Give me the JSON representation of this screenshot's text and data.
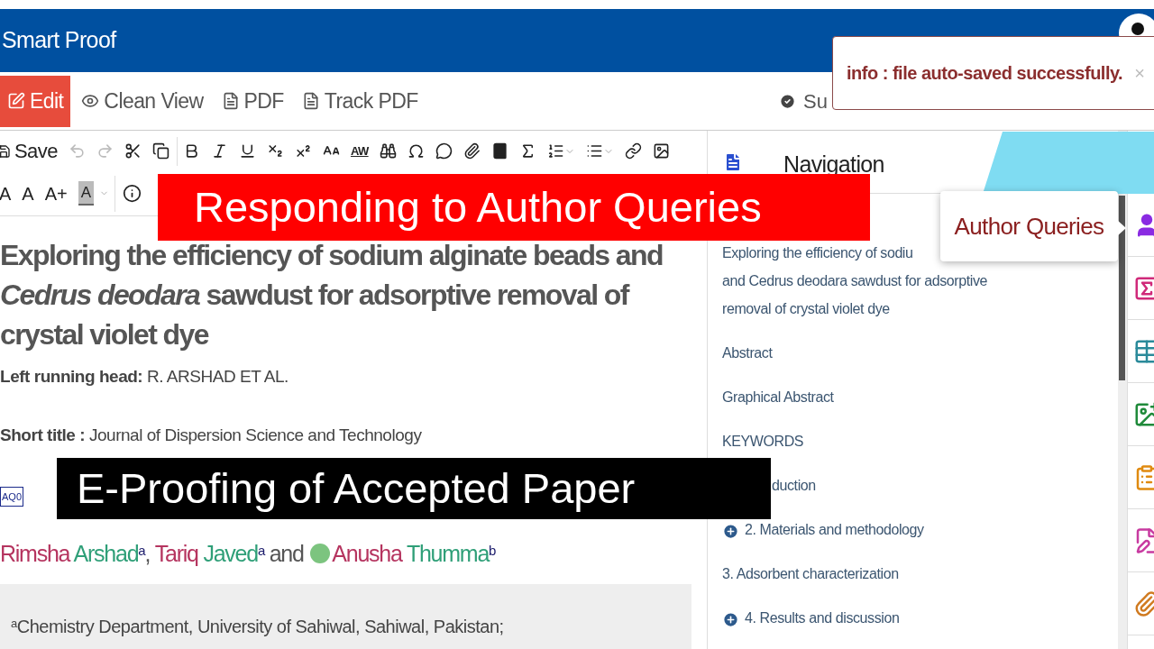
{
  "header": {
    "title": "Smart Proof"
  },
  "menu": {
    "tabs": [
      {
        "label": "Edit",
        "selected": true
      },
      {
        "label": "Clean View",
        "selected": false
      },
      {
        "label": "PDF",
        "selected": false
      },
      {
        "label": "Track PDF",
        "selected": false
      }
    ],
    "status_label": "Su"
  },
  "toast": {
    "message": "info : file auto-saved successfully.",
    "close": "×"
  },
  "toolbar": {
    "save": "Save",
    "undo_disabled": true,
    "redo_disabled": true,
    "spell_label": "AW",
    "font_buttons": [
      "A",
      "A",
      "A+"
    ],
    "highlight_label": "A"
  },
  "document": {
    "title": "Exploring the efficiency of sodium alginate beads and *Cedrus deodara* sawdust for adsorptive removal of crystal violet dye",
    "running_head": {
      "label": "Left running head:",
      "value": "R. ARSHAD ET AL."
    },
    "short_title": {
      "label": "Short title :",
      "value": "Journal of Dispersion Science and Technology"
    },
    "query_marker": "AQ0",
    "authors": [
      {
        "given": "Rimsha",
        "family": "Arshad",
        "affiliation": "a",
        "orcid": false,
        "after": ", "
      },
      {
        "given": "Tariq",
        "family": "Javed",
        "affiliation": "a",
        "orcid": false,
        "after": " and "
      },
      {
        "given": "Anusha",
        "family": "Thumma",
        "affiliation": "b",
        "orcid": true
      }
    ],
    "affiliation": {
      "mark": "a",
      "text": "Chemistry Department, University of Sahiwal, Sahiwal, Pakistan;"
    }
  },
  "navigation": {
    "title": "Navigation",
    "tooltip": "Author Queries",
    "items": [
      {
        "kind": "plain",
        "covered": false,
        "lines": [
          "Exploring the efficiency of sodiu",
          "and Cedrus deodara sawdust for adsorptive",
          "removal of crystal violet dye"
        ]
      },
      {
        "kind": "plain",
        "covered": false,
        "lines": [
          "Abstract"
        ]
      },
      {
        "kind": "plain",
        "covered": false,
        "lines": [
          "Graphical Abstract"
        ]
      },
      {
        "kind": "plain",
        "covered": false,
        "lines": [
          "KEYWORDS"
        ]
      },
      {
        "kind": "plain",
        "covered": true,
        "lines": [
          "duction"
        ]
      },
      {
        "kind": "expandable",
        "covered": false,
        "lines": [
          "2. Materials and methodology"
        ]
      },
      {
        "kind": "plain",
        "covered": false,
        "lines": [
          "3. Adsorbent characterization"
        ]
      },
      {
        "kind": "expandable",
        "covered": false,
        "lines": [
          "4. Results and discussion"
        ]
      }
    ]
  },
  "captions": [
    {
      "text": "Responding to Author Queries",
      "color": "#ff0000"
    },
    {
      "text": "E-Proofing of Accepted Paper",
      "color": "#000000"
    }
  ]
}
